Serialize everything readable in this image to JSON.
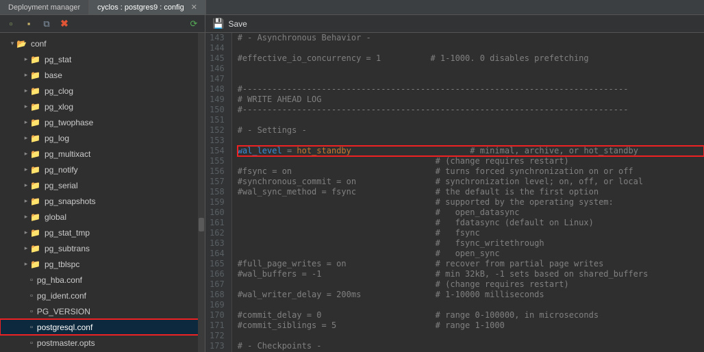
{
  "tabs": [
    {
      "label": "Deployment manager"
    },
    {
      "label": "cyclos : postgres9 : config",
      "active": true
    }
  ],
  "toolbar": {
    "save_label": "Save"
  },
  "tree": {
    "root": {
      "label": "conf",
      "expanded": true
    },
    "items": [
      {
        "label": "pg_stat",
        "type": "folder"
      },
      {
        "label": "base",
        "type": "folder"
      },
      {
        "label": "pg_clog",
        "type": "folder"
      },
      {
        "label": "pg_xlog",
        "type": "folder"
      },
      {
        "label": "pg_twophase",
        "type": "folder"
      },
      {
        "label": "pg_log",
        "type": "folder"
      },
      {
        "label": "pg_multixact",
        "type": "folder"
      },
      {
        "label": "pg_notify",
        "type": "folder"
      },
      {
        "label": "pg_serial",
        "type": "folder"
      },
      {
        "label": "pg_snapshots",
        "type": "folder"
      },
      {
        "label": "global",
        "type": "folder"
      },
      {
        "label": "pg_stat_tmp",
        "type": "folder"
      },
      {
        "label": "pg_subtrans",
        "type": "folder"
      },
      {
        "label": "pg_tblspc",
        "type": "folder"
      },
      {
        "label": "pg_hba.conf",
        "type": "file"
      },
      {
        "label": "pg_ident.conf",
        "type": "file"
      },
      {
        "label": "PG_VERSION",
        "type": "file"
      },
      {
        "label": "postgresql.conf",
        "type": "file",
        "selected": true,
        "highlighted": true
      },
      {
        "label": "postmaster.opts",
        "type": "file"
      }
    ]
  },
  "editor": {
    "first_line": 143,
    "highlight_line": 154,
    "lines": [
      {
        "n": 143,
        "raw": "# - Asynchronous Behavior -"
      },
      {
        "n": 144,
        "raw": ""
      },
      {
        "n": 145,
        "raw": "#effective_io_concurrency = 1          # 1-1000. 0 disables prefetching"
      },
      {
        "n": 146,
        "raw": ""
      },
      {
        "n": 147,
        "raw": ""
      },
      {
        "n": 148,
        "raw": "#------------------------------------------------------------------------------"
      },
      {
        "n": 149,
        "raw": "# WRITE AHEAD LOG"
      },
      {
        "n": 150,
        "raw": "#------------------------------------------------------------------------------"
      },
      {
        "n": 151,
        "raw": ""
      },
      {
        "n": 152,
        "raw": "# - Settings -"
      },
      {
        "n": 153,
        "raw": ""
      },
      {
        "n": 154,
        "kw": "wal_level",
        "eq": " = ",
        "val": "hot_standby",
        "pad": "                        ",
        "cmt": "# minimal, archive, or hot_standby"
      },
      {
        "n": 155,
        "raw": "                                        # (change requires restart)"
      },
      {
        "n": 156,
        "raw": "#fsync = on                             # turns forced synchronization on or off"
      },
      {
        "n": 157,
        "raw": "#synchronous_commit = on                # synchronization level; on, off, or local"
      },
      {
        "n": 158,
        "raw": "#wal_sync_method = fsync                # the default is the first option"
      },
      {
        "n": 159,
        "raw": "                                        # supported by the operating system:"
      },
      {
        "n": 160,
        "raw": "                                        #   open_datasync"
      },
      {
        "n": 161,
        "raw": "                                        #   fdatasync (default on Linux)"
      },
      {
        "n": 162,
        "raw": "                                        #   fsync"
      },
      {
        "n": 163,
        "raw": "                                        #   fsync_writethrough"
      },
      {
        "n": 164,
        "raw": "                                        #   open_sync"
      },
      {
        "n": 165,
        "raw": "#full_page_writes = on                  # recover from partial page writes"
      },
      {
        "n": 166,
        "raw": "#wal_buffers = -1                       # min 32kB, -1 sets based on shared_buffers"
      },
      {
        "n": 167,
        "raw": "                                        # (change requires restart)"
      },
      {
        "n": 168,
        "raw": "#wal_writer_delay = 200ms               # 1-10000 milliseconds"
      },
      {
        "n": 169,
        "raw": ""
      },
      {
        "n": 170,
        "raw": "#commit_delay = 0                       # range 0-100000, in microseconds"
      },
      {
        "n": 171,
        "raw": "#commit_siblings = 5                    # range 1-1000"
      },
      {
        "n": 172,
        "raw": ""
      },
      {
        "n": 173,
        "raw": "# - Checkpoints -"
      }
    ]
  }
}
